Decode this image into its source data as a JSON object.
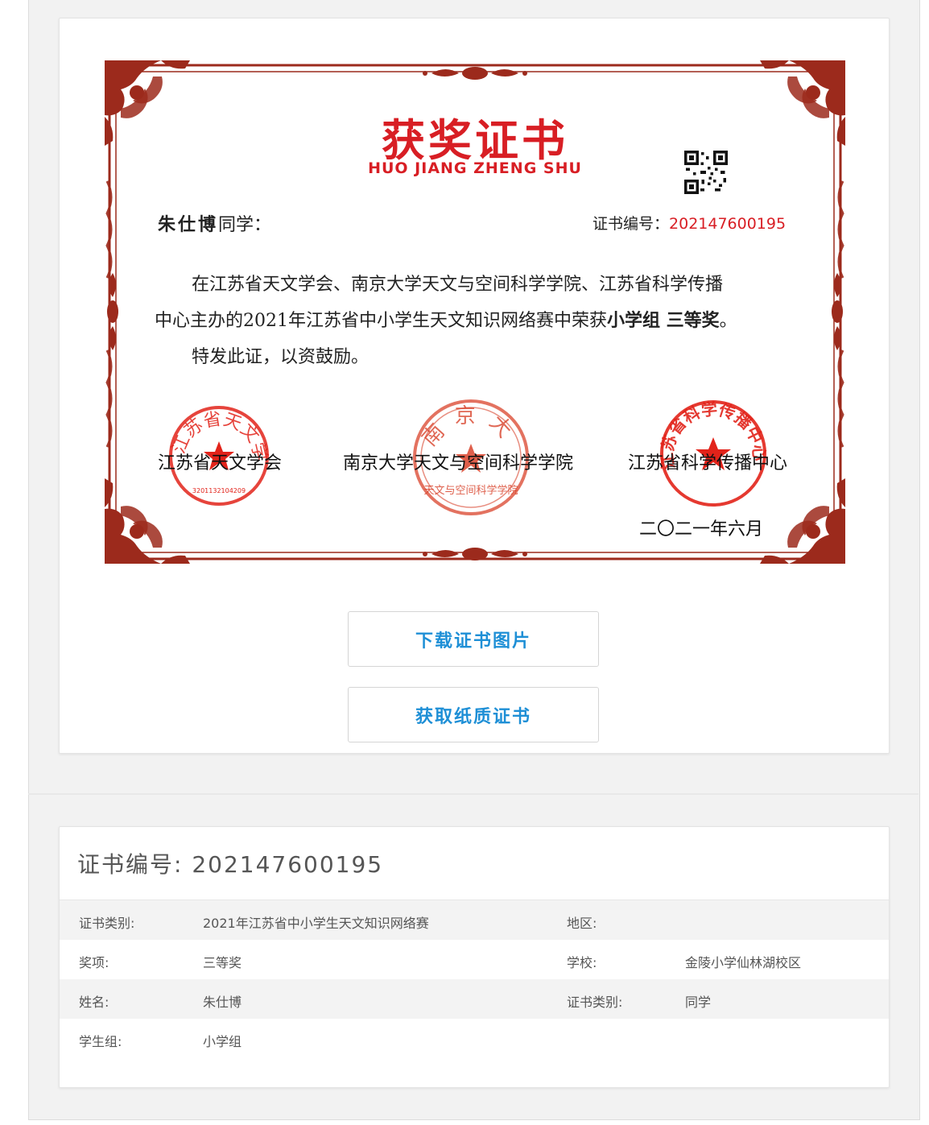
{
  "certificate": {
    "title": "获奖证书",
    "subtitle": "HUO JIANG ZHENG SHU",
    "recipient_name": "朱仕博",
    "recipient_suffix": "同学：",
    "number_label": "证书编号：",
    "number_value": "202147600195",
    "body_line1": "在江苏省天文学会、南京大学天文与空间科学学院、江苏省科学传播",
    "body_line2_prefix": "中心主办的2021年江苏省中小学生天文知识网络赛中荣获",
    "body_award": "小学组 三等奖",
    "body_line2_suffix": "。",
    "body_line3": "特发此证，以资鼓励。",
    "org1": "江苏省天文学会",
    "org2": "南京大学天文与空间科学学院",
    "org3": "江苏省科学传播中心",
    "date": "二〇二一年六月",
    "stamp1_text": "江苏省天文学会",
    "stamp1_code": "3201132104209",
    "stamp2_text": "南京大学",
    "stamp2_bottom": "天文与空间科学学院",
    "stamp3_text": "江苏省科学传播中心",
    "accent_color": "#d81e24",
    "frame_color": "#9c2a1c"
  },
  "buttons": {
    "download": "下载证书图片",
    "paper": "获取纸质证书"
  },
  "details": {
    "header": "证书编号: 202147600195",
    "rows": [
      {
        "label1": "证书类别:",
        "value1": "2021年江苏省中小学生天文知识网络赛",
        "label2": "地区:",
        "value2": ""
      },
      {
        "label1": "奖项:",
        "value1": "三等奖",
        "label2": "学校:",
        "value2": "金陵小学仙林湖校区"
      },
      {
        "label1": "姓名:",
        "value1": "朱仕博",
        "label2": "证书类别:",
        "value2": "同学"
      },
      {
        "label1": "学生组:",
        "value1": "小学组",
        "label2": "",
        "value2": ""
      }
    ]
  },
  "colors": {
    "button_text": "#1e8fd6"
  }
}
